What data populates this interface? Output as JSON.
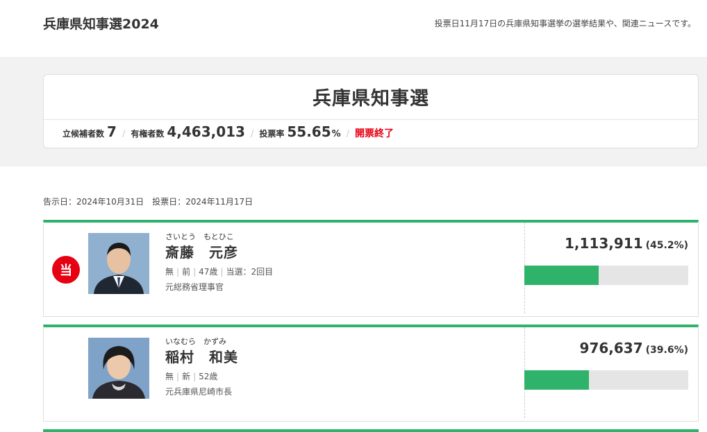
{
  "header": {
    "title": "兵庫県知事選2024",
    "description": "投票日11月17日の兵庫県知事選挙の選挙結果や、関連ニュースです。"
  },
  "summary": {
    "title": "兵庫県知事選",
    "candidates_label": "立候補者数",
    "candidates_value": "7",
    "voters_label": "有権者数",
    "voters_value": "4,463,013",
    "turnout_label": "投票率",
    "turnout_value": "55.65",
    "turnout_unit": "%",
    "status": "開票終了"
  },
  "dates": "告示日：2024年10月31日　投票日：2024年11月17日",
  "colors": {
    "accent": "#2fb36a",
    "winner": "#e60012",
    "band": "#f2f2f2"
  },
  "candidates": [
    {
      "winner_badge": "当",
      "kana": "さいとう　もとひこ",
      "name": "斎藤　元彦",
      "party": "無",
      "status": "前",
      "age": "47歳",
      "elected": "当選：2回目",
      "career": "元総務省理事官",
      "votes": "1,113,911",
      "rate": "(45.2%)",
      "share": 45.2
    },
    {
      "kana": "いなむら　かずみ",
      "name": "稲村　和美",
      "party": "無",
      "status": "新",
      "age": "52歳",
      "career": "元兵庫県尼崎市長",
      "votes": "976,637",
      "rate": "(39.6%)",
      "share": 39.6
    }
  ]
}
